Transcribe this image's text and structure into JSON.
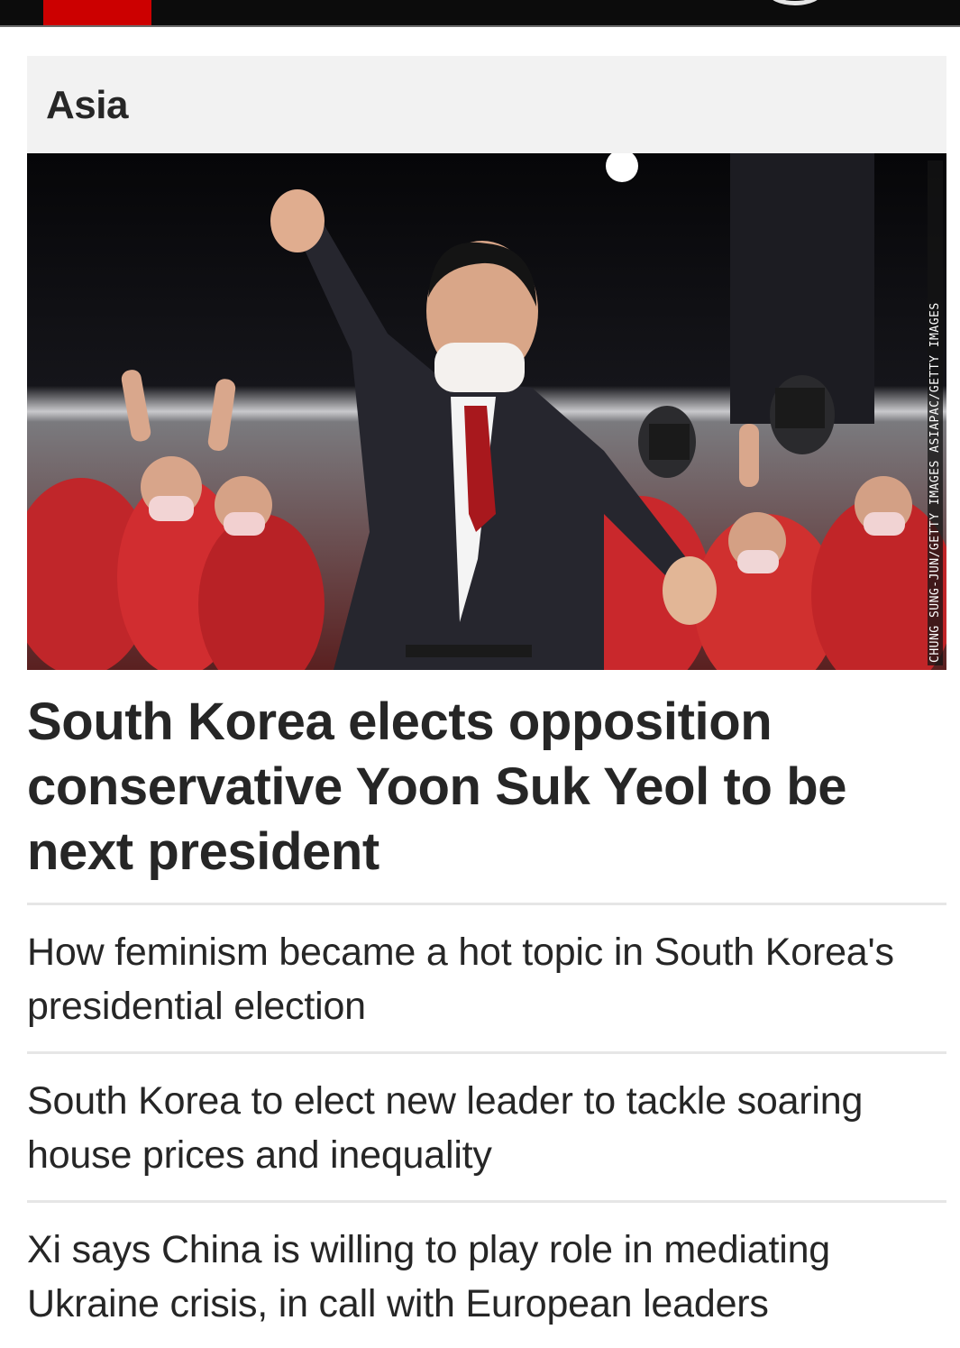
{
  "header": {
    "brand_color": "#cc0000",
    "icons": [
      "logo",
      "user-icon"
    ]
  },
  "section": {
    "title": "Asia"
  },
  "hero": {
    "credit": "Chung Sung-Jun/Getty Images AsiaPac/Getty Images"
  },
  "lead_story": {
    "headline": "South Korea elects opposition conservative Yoon Suk Yeol to be next president"
  },
  "stories": [
    {
      "title": "How feminism became a hot topic in South Korea's presidential election"
    },
    {
      "title": "South Korea to elect new leader to tackle soaring house prices and inequality"
    },
    {
      "title": "Xi says China is willing to play role in mediating Ukraine crisis, in call with European leaders"
    }
  ]
}
